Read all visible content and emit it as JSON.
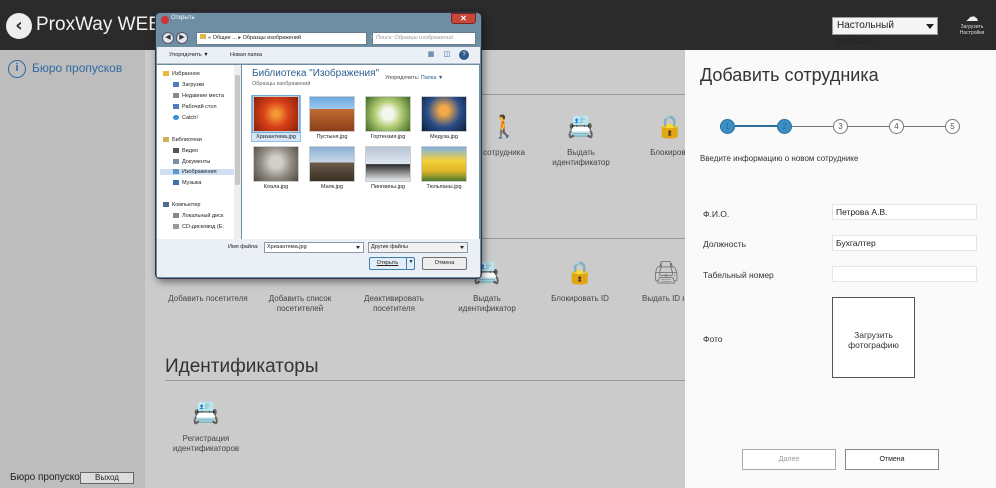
{
  "app": {
    "title": "ProxWay WEB",
    "reader_select": "Настольный считыв...",
    "load_settings": "Загрузить\nНастройки"
  },
  "sidebar": {
    "item": "Бюро пропусков",
    "bottom_label": "Бюро пропусков",
    "logout": "Выход"
  },
  "main": {
    "row1_tiles": [
      "сотрудника",
      "Выдать идентификатор",
      "Блокирова"
    ],
    "row2_tiles": [
      "Добавить посетителя",
      "Добавить список посетителей",
      "Деактивировать посетителя",
      "Выдать идентификатор",
      "Блокировать ID",
      "Выдать ID в"
    ],
    "ident_section_title": "Идентификаторы",
    "ident_tile": "Регистрация идентификаторов"
  },
  "panel": {
    "title": "Добавить сотрудника",
    "steps": [
      "1",
      "2",
      "3",
      "4",
      "5"
    ],
    "active_steps": 2,
    "hint": "Введите информацию о новом сотруднике",
    "fields": [
      {
        "label": "Ф.И.О.",
        "value": "Петрова А.В."
      },
      {
        "label": "Должность",
        "value": "Бухгалтер"
      },
      {
        "label": "Табельный номер",
        "value": ""
      }
    ],
    "photo_label": "Фото",
    "photo_button": "Загрузить фотографию",
    "next": "Далее",
    "cancel": "Отмена"
  },
  "dialog": {
    "title": "Открыть",
    "address": "« Общие ... ▸ Образцы изображений",
    "search_placeholder": "Поиск: Образцы изображений",
    "organize": "Упорядочить ▼",
    "new_folder": "Новая папка",
    "nav": [
      {
        "label": "Избранное",
        "color": "#e8b93a"
      },
      {
        "label": "Загрузки",
        "color": "#4c7fb8"
      },
      {
        "label": "Недавние места",
        "color": "#8a8a8a"
      },
      {
        "label": "Рабочий стол",
        "color": "#4c7fb8"
      },
      {
        "label": "Catch!",
        "color": "#3a8fd0"
      },
      {
        "label": "Библиотеки",
        "color": "#d4b05a"
      },
      {
        "label": "Видео",
        "color": "#555"
      },
      {
        "label": "Документы",
        "color": "#7a8ea4"
      },
      {
        "label": "Изображения",
        "color": "#5b9ac9"
      },
      {
        "label": "Музыка",
        "color": "#3a6fb0"
      },
      {
        "label": "Компьютер",
        "color": "#4a6e90"
      },
      {
        "label": "Локальный диск",
        "color": "#888"
      },
      {
        "label": "CD-дисковод (E:",
        "color": "#999"
      }
    ],
    "library_title": "Библиотека \"Изображения\"",
    "library_sub": "Образцы изображений",
    "arrange_label": "Упорядочить:",
    "arrange_value": "Папка ▼",
    "thumbs": [
      {
        "name": "Хризантема.jpg",
        "color": "#d9421a"
      },
      {
        "name": "Пустыня.jpg",
        "color": "#b8652e"
      },
      {
        "name": "Гортензия.jpg",
        "color": "#6f9a3a"
      },
      {
        "name": "Медуза.jpg",
        "color": "#2a4f8a"
      },
      {
        "name": "Коала.jpg",
        "color": "#8e8a82"
      },
      {
        "name": "Маяк.jpg",
        "color": "#6a5a4a"
      },
      {
        "name": "Пингвины.jpg",
        "color": "#9aa7b8"
      },
      {
        "name": "Тюльпаны.jpg",
        "color": "#e0b52a"
      }
    ],
    "filename_label": "Имя файла:",
    "filename_value": "Хризантема.jpg",
    "filetype": "Другие файлы",
    "open": "Открыть",
    "cancel": "Отмена"
  }
}
